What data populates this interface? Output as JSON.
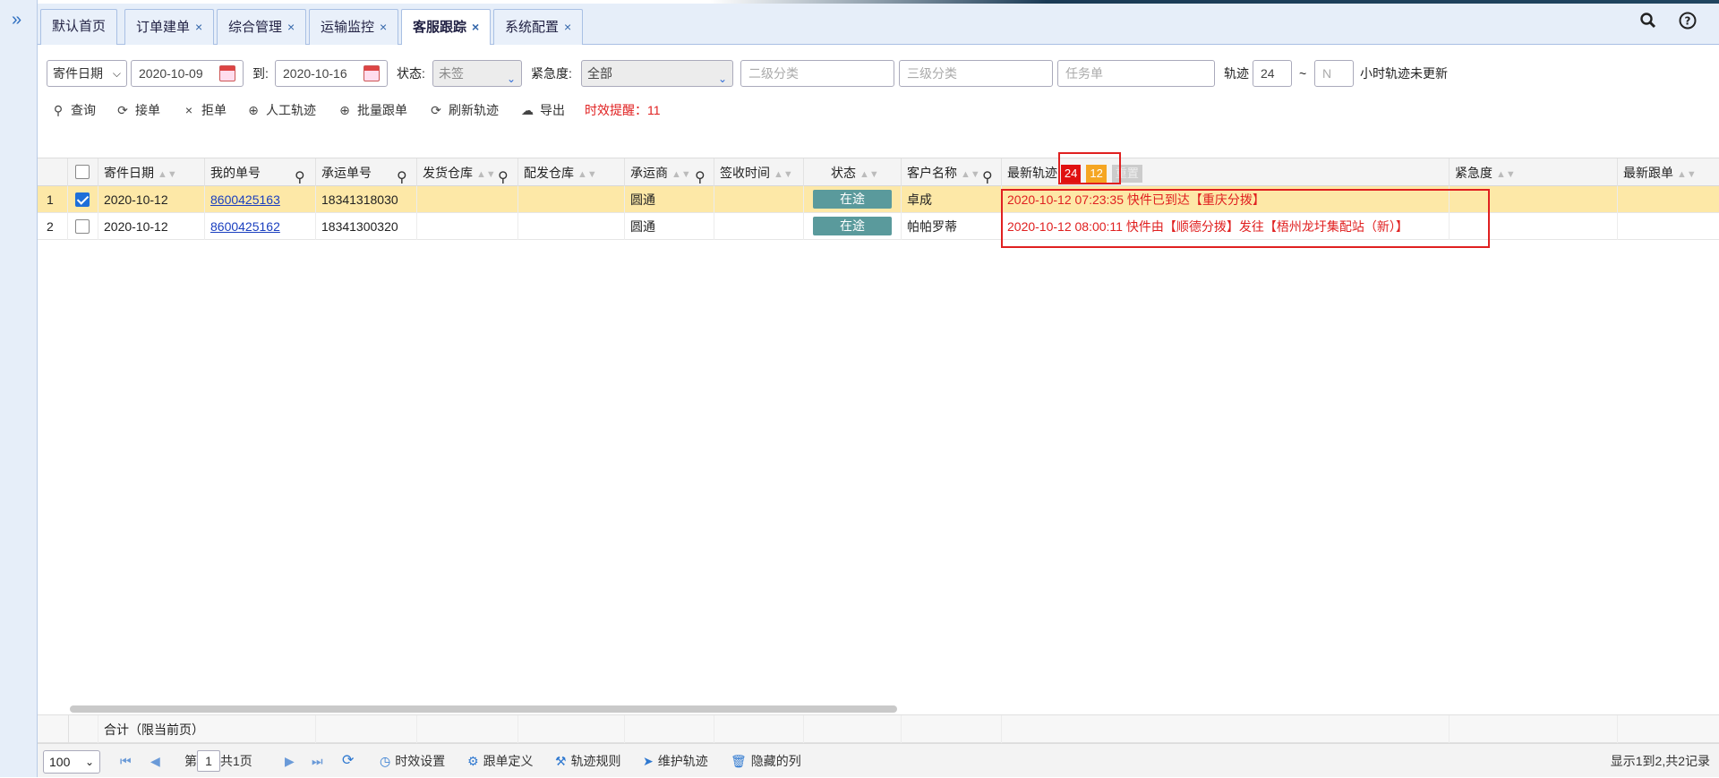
{
  "tabs": [
    {
      "label": "默认首页",
      "closable": false
    },
    {
      "label": "订单建单",
      "closable": true
    },
    {
      "label": "综合管理",
      "closable": true
    },
    {
      "label": "运输监控",
      "closable": true
    },
    {
      "label": "客服跟踪",
      "closable": true,
      "active": true
    },
    {
      "label": "系统配置",
      "closable": true
    }
  ],
  "close_glyph": "×",
  "icons": {
    "search": "search-icon",
    "help": "help-icon",
    "settings": "gear-icon"
  },
  "filters": {
    "date_type": "寄件日期",
    "date_from": "2020-10-09",
    "to_label": "到:",
    "date_to": "2020-10-16",
    "status_label": "状态:",
    "status_value": "未签",
    "urgency_label": "紧急度:",
    "urgency_value": "全部",
    "level2_placeholder": "二级分类",
    "level3_placeholder": "三级分类",
    "task_placeholder": "任务单",
    "track_label": "轨迹",
    "track_value": "24",
    "tilde": "~",
    "track_n_placeholder": "N",
    "track_suffix": "小时轨迹未更新"
  },
  "actions": {
    "query": "查询",
    "accept": "接单",
    "reject": "拒单",
    "manual_track": "人工轨迹",
    "batch_follow": "批量跟单",
    "refresh_track": "刷新轨迹",
    "export": "导出",
    "timeliness_alert": "时效提醒：11"
  },
  "columns": {
    "send_date": "寄件日期",
    "my_no": "我的单号",
    "carrier_no": "承运单号",
    "ship_wh": "发货仓库",
    "dist_wh": "配发仓库",
    "carrier": "承运商",
    "sign_time": "签收时间",
    "status": "状态",
    "customer": "客户名称",
    "latest_track": "最新轨迹",
    "badge_red": "24",
    "badge_orange": "12",
    "badge_reset": "重置",
    "urgency": "紧急度",
    "latest_follow": "最新跟单"
  },
  "rows": [
    {
      "n": "1",
      "checked": true,
      "send_date": "2020-10-12",
      "my_no": "8600425163",
      "carrier_no": "18341318030",
      "carrier": "圆通",
      "status": "在途",
      "customer": "卓成",
      "track": "2020-10-12 07:23:35 快件已到达【重庆分拨】"
    },
    {
      "n": "2",
      "checked": false,
      "send_date": "2020-10-12",
      "my_no": "8600425162",
      "carrier_no": "18341300320",
      "carrier": "圆通",
      "status": "在途",
      "customer": "帕帕罗蒂",
      "track": "2020-10-12 08:00:11 快件由【顺德分拨】发往【梧州龙圩集配站（新）】"
    }
  ],
  "totals_label": "合计（限当前页）",
  "pager": {
    "page_size": "100",
    "page_prefix": "第",
    "page_value": "1",
    "page_total": "共1页",
    "time_setting": "时效设置",
    "follow_def": "跟单定义",
    "track_rules": "轨迹规则",
    "maintain_track": "维护轨迹",
    "hidden_cols": "隐藏的列",
    "summary": "显示1到2,共2记录"
  }
}
